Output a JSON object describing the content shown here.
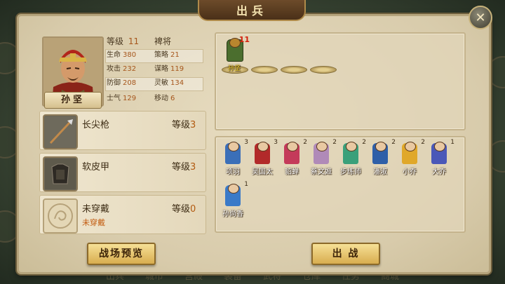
{
  "window": {
    "title": "出兵"
  },
  "hero": {
    "name": "孙坚",
    "level_label": "等级",
    "level": "11",
    "rank": "裨将",
    "stats": [
      {
        "label": "生命",
        "value": "380"
      },
      {
        "label": "策略",
        "value": "21"
      },
      {
        "label": "攻击",
        "value": "232"
      },
      {
        "label": "谋略",
        "value": "119"
      },
      {
        "label": "防御",
        "value": "208"
      },
      {
        "label": "灵敏",
        "value": "134"
      },
      {
        "label": "士气",
        "value": "129"
      },
      {
        "label": "移动",
        "value": "6"
      }
    ]
  },
  "equipment": [
    {
      "name": "长尖枪",
      "level_label": "等级",
      "level": "3",
      "sub": "",
      "icon": "spear-icon"
    },
    {
      "name": "软皮甲",
      "level_label": "等级",
      "level": "3",
      "sub": "",
      "icon": "armor-icon"
    },
    {
      "name": "未穿戴",
      "level_label": "等级",
      "level": "0",
      "sub": "未穿戴",
      "icon": "dragon-emblem-icon"
    }
  ],
  "formation": {
    "deployed": [
      {
        "name": "孙坚",
        "level": "11"
      }
    ]
  },
  "roster": [
    {
      "name": "项羽",
      "level": "3"
    },
    {
      "name": "吴国太",
      "level": "3"
    },
    {
      "name": "貂蝉",
      "level": "2"
    },
    {
      "name": "蔡文姬",
      "level": "2"
    },
    {
      "name": "步练师",
      "level": "2"
    },
    {
      "name": "潘淑",
      "level": "2"
    },
    {
      "name": "小乔",
      "level": "2"
    },
    {
      "name": "大乔",
      "level": "1"
    },
    {
      "name": "孙尚香",
      "level": "1"
    }
  ],
  "buttons": {
    "preview": "战场预览",
    "deploy": "出 战",
    "close": "✕"
  },
  "background_tabs": [
    "出兵",
    "城市",
    "宫殿",
    "装备",
    "武将",
    "仓库",
    "任务",
    "商城"
  ],
  "colors": {
    "parchment": "#ddd2b5",
    "accent": "#b25a10",
    "button": "#e8c46a"
  }
}
